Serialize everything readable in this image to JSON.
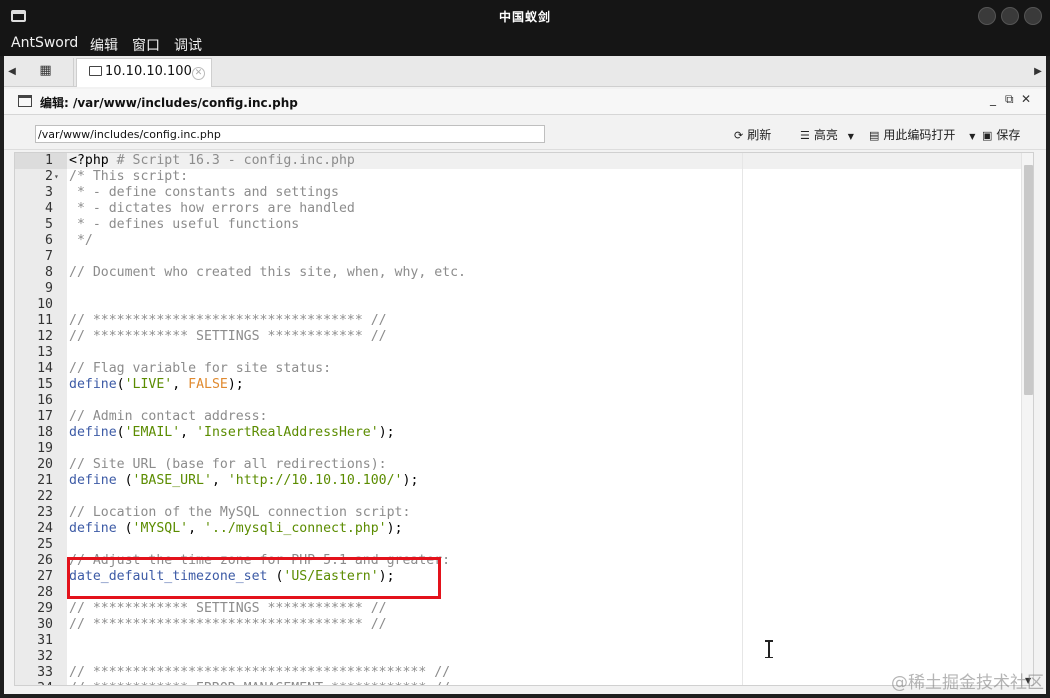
{
  "window": {
    "title": "中国蚁剑"
  },
  "menu": [
    "AntSword",
    "编辑",
    "窗口",
    "调试"
  ],
  "tabs": {
    "home_icon": "grid-icon",
    "active_label": "10.10.10.100"
  },
  "panel": {
    "title": "编辑: /var/www/includes/config.inc.php",
    "controls": {
      "minimize": "_",
      "restore": "⧉",
      "close": "✕"
    }
  },
  "toolbar": {
    "path_value": "/var/www/includes/config.inc.php",
    "refresh_label": "刷新",
    "highlight_label": "高亮",
    "encoding_label": "用此编码打开",
    "save_label": "保存"
  },
  "editor": {
    "lines": [
      {
        "n": "1",
        "fold": false,
        "tokens": [
          [
            "",
            "<?php "
          ],
          [
            "c",
            "# Script 16.3 - config.inc.php"
          ]
        ]
      },
      {
        "n": "2",
        "fold": true,
        "tokens": [
          [
            "c",
            "/* This script:"
          ]
        ]
      },
      {
        "n": "3",
        "fold": false,
        "tokens": [
          [
            "c",
            " * - define constants and settings"
          ]
        ]
      },
      {
        "n": "4",
        "fold": false,
        "tokens": [
          [
            "c",
            " * - dictates how errors are handled"
          ]
        ]
      },
      {
        "n": "5",
        "fold": false,
        "tokens": [
          [
            "c",
            " * - defines useful functions"
          ]
        ]
      },
      {
        "n": "6",
        "fold": false,
        "tokens": [
          [
            "c",
            " */"
          ]
        ]
      },
      {
        "n": "7",
        "fold": false,
        "tokens": []
      },
      {
        "n": "8",
        "fold": false,
        "tokens": [
          [
            "c",
            "// Document who created this site, when, why, etc."
          ]
        ]
      },
      {
        "n": "9",
        "fold": false,
        "tokens": []
      },
      {
        "n": "10",
        "fold": false,
        "tokens": []
      },
      {
        "n": "11",
        "fold": false,
        "tokens": [
          [
            "c",
            "// ********************************** //"
          ]
        ]
      },
      {
        "n": "12",
        "fold": false,
        "tokens": [
          [
            "c",
            "// ************ SETTINGS ************ //"
          ]
        ]
      },
      {
        "n": "13",
        "fold": false,
        "tokens": []
      },
      {
        "n": "14",
        "fold": false,
        "tokens": [
          [
            "c",
            "// Flag variable for site status:"
          ]
        ]
      },
      {
        "n": "15",
        "fold": false,
        "tokens": [
          [
            "k",
            "define"
          ],
          [
            "",
            "("
          ],
          [
            "s",
            "'LIVE'"
          ],
          [
            "",
            ", "
          ],
          [
            "b",
            "FALSE"
          ],
          [
            "",
            ");"
          ]
        ]
      },
      {
        "n": "16",
        "fold": false,
        "tokens": []
      },
      {
        "n": "17",
        "fold": false,
        "tokens": [
          [
            "c",
            "// Admin contact address:"
          ]
        ]
      },
      {
        "n": "18",
        "fold": false,
        "tokens": [
          [
            "k",
            "define"
          ],
          [
            "",
            "("
          ],
          [
            "s",
            "'EMAIL'"
          ],
          [
            "",
            ", "
          ],
          [
            "s",
            "'InsertRealAddressHere'"
          ],
          [
            "",
            ");"
          ]
        ]
      },
      {
        "n": "19",
        "fold": false,
        "tokens": []
      },
      {
        "n": "20",
        "fold": false,
        "tokens": [
          [
            "c",
            "// Site URL (base for all redirections):"
          ]
        ]
      },
      {
        "n": "21",
        "fold": false,
        "tokens": [
          [
            "k",
            "define"
          ],
          [
            "",
            " ("
          ],
          [
            "s",
            "'BASE_URL'"
          ],
          [
            "",
            ", "
          ],
          [
            "s",
            "'http://10.10.10.100/'"
          ],
          [
            "",
            ");"
          ]
        ]
      },
      {
        "n": "22",
        "fold": false,
        "tokens": []
      },
      {
        "n": "23",
        "fold": false,
        "tokens": [
          [
            "c",
            "// Location of the MySQL connection script:"
          ]
        ]
      },
      {
        "n": "24",
        "fold": false,
        "tokens": [
          [
            "k",
            "define"
          ],
          [
            "",
            " ("
          ],
          [
            "s",
            "'MYSQL'"
          ],
          [
            "",
            ", "
          ],
          [
            "s",
            "'../mysqli_connect.php'"
          ],
          [
            "",
            ");"
          ]
        ]
      },
      {
        "n": "25",
        "fold": false,
        "tokens": []
      },
      {
        "n": "26",
        "fold": false,
        "tokens": [
          [
            "c",
            "// Adjust the time zone for PHP 5.1 and greater:"
          ]
        ]
      },
      {
        "n": "27",
        "fold": false,
        "tokens": [
          [
            "k",
            "date_default_timezone_set"
          ],
          [
            "",
            " ("
          ],
          [
            "s",
            "'US/Eastern'"
          ],
          [
            "",
            ");"
          ]
        ]
      },
      {
        "n": "28",
        "fold": false,
        "tokens": []
      },
      {
        "n": "29",
        "fold": false,
        "tokens": [
          [
            "c",
            "// ************ SETTINGS ************ //"
          ]
        ]
      },
      {
        "n": "30",
        "fold": false,
        "tokens": [
          [
            "c",
            "// ********************************** //"
          ]
        ]
      },
      {
        "n": "31",
        "fold": false,
        "tokens": []
      },
      {
        "n": "32",
        "fold": false,
        "tokens": []
      },
      {
        "n": "33",
        "fold": false,
        "tokens": [
          [
            "c",
            "// ****************************************** //"
          ]
        ]
      },
      {
        "n": "34",
        "fold": false,
        "tokens": [
          [
            "c",
            "// ************ ERROR MANAGEMENT ************ //"
          ]
        ]
      }
    ]
  },
  "watermark": "@稀土掘金技术社区"
}
